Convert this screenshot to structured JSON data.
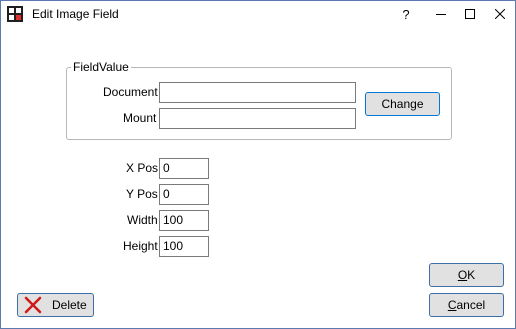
{
  "window": {
    "title": "Edit Image Field"
  },
  "titlebar_buttons": {
    "help": "?"
  },
  "field_value": {
    "group_label": "FieldValue",
    "document_label": "Document",
    "document_value": "",
    "mount_label": "Mount",
    "mount_value": "",
    "change_label": "Change"
  },
  "position": {
    "xpos_label": "X Pos",
    "xpos_value": "0",
    "ypos_label": "Y Pos",
    "ypos_value": "0",
    "width_label": "Width",
    "width_value": "100",
    "height_label": "Height",
    "height_value": "100"
  },
  "buttons": {
    "ok_label_mnemonic": "O",
    "ok_label_rest": "K",
    "cancel_label_mnemonic": "C",
    "cancel_label_rest": "ancel",
    "delete_label": "Delete"
  },
  "icons": {
    "app": "grid-app-icon",
    "minimize": "minimize-icon",
    "maximize": "maximize-icon",
    "close": "close-icon",
    "delete": "red-x-icon"
  },
  "colors": {
    "delete_icon": "#d01818",
    "focus_border": "#0078d7"
  }
}
